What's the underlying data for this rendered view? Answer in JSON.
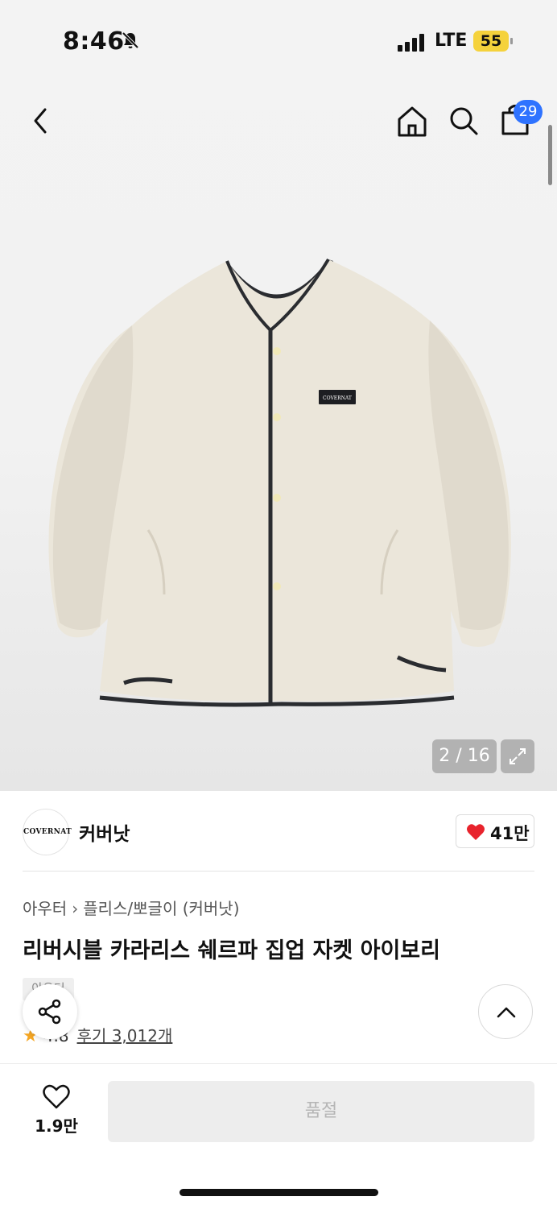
{
  "status_bar": {
    "time": "8:46",
    "network": "LTE",
    "battery": "55"
  },
  "header": {
    "cart_count": "29"
  },
  "gallery": {
    "counter": "2 / 16"
  },
  "product_image": {
    "brand_label": "COVERNAT"
  },
  "brand": {
    "logo_text": "COVERNAT",
    "name": "커버낫",
    "like_count": "41만"
  },
  "product": {
    "breadcrumb": {
      "category": "아우터",
      "subcategory": "플리스/뽀글이 (커버낫)"
    },
    "title": "리버시블 카라리스 쉐르파 집업 자켓 아이보리",
    "tag": "아우터",
    "rating": {
      "score": "4.8",
      "reviews": "후기 3,012개"
    }
  },
  "bottom_bar": {
    "wish_count": "1.9만",
    "buy_label": "품절"
  },
  "colors": {
    "accent": "#2f73ff",
    "heart": "#e8232c",
    "star": "#f5a623",
    "battery": "#f5d23c"
  }
}
